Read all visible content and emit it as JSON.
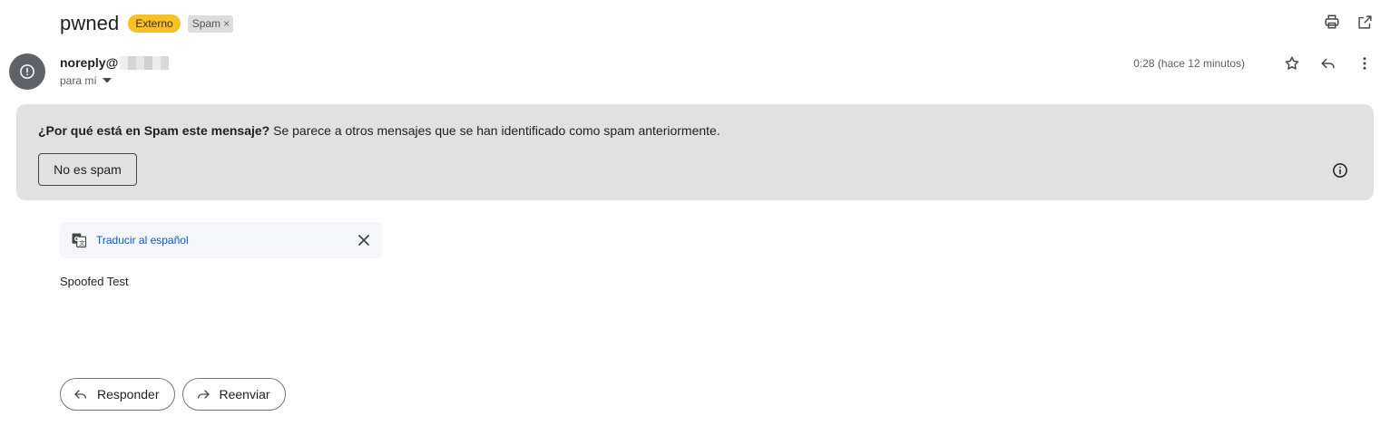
{
  "email": {
    "subject": "pwned",
    "labels": {
      "external": "Externo",
      "spam": "Spam",
      "spam_remove": "×"
    },
    "sender": {
      "name_prefix": "noreply@",
      "recipient": "para mí"
    },
    "timestamp": "0:28 (hace 12 minutos)",
    "body": "Spoofed Test"
  },
  "spam_banner": {
    "question": "¿Por qué está en Spam este mensaje?",
    "explanation": " Se parece a otros mensajes que se han identificado como spam anteriormente.",
    "not_spam_label": "No es spam"
  },
  "translate": {
    "link_label": "Traducir al español"
  },
  "actions": {
    "reply_label": "Responder",
    "forward_label": "Reenviar"
  },
  "icons": {
    "print": "print-icon",
    "open_new_window": "open-in-new-window-icon",
    "star": "star-icon",
    "reply": "reply-icon",
    "more": "more-vertical-icon",
    "info": "info-icon",
    "translate": "translate-icon",
    "close": "close-icon",
    "avatar": "warning-avatar-icon"
  },
  "colors": {
    "external_badge": "#f6c026",
    "spam_badge": "#dddddd",
    "banner_bg": "#e1e1e1",
    "link": "#0b57d0",
    "avatar_bg": "#5f6368"
  }
}
